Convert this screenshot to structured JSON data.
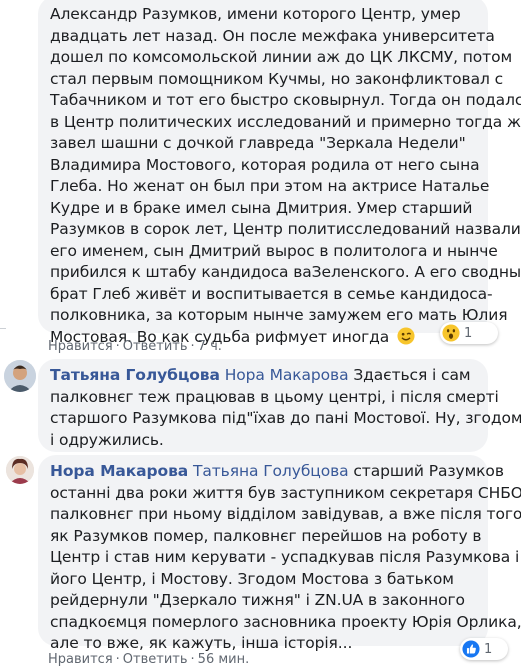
{
  "comment1": {
    "lines": [
      "Александр Разумков, имени которого Центр, умер",
      "двадцать лет назад. Он после межфака университета",
      "дошел по комсомольской линии аж до ЦК ЛКСМУ, потом",
      "стал первым помощником Кучмы, но законфликтовал с",
      "Табачником и тот его быстро сковырнул. Тогда он подался",
      "в Центр политических исследований и примерно тогда же",
      "завел шашни с дочкой главреда \"Зеркала Недели\"",
      "Владимира Мостового, которая родила от него сына",
      "Глеба. Но женат он был при этом на актрисе Наталье",
      "Кудре и в браке имел сына Дмитрия. Умер старший",
      "Разумков в сорок лет, Центр политисследований назвали",
      "его именем, сын Дмитрий вырос в политолога и нынче",
      "прибился к штабу кандидоса ваЗеленского. А его сводный",
      "брат Глеб живёт и воспитывается в семье кандидоса-",
      "полковника, за которым нынче замужем его мать Юлия"
    ],
    "last_line": "Мостовая. Во как судьба рифмует иногда",
    "emoji": "wink-emoji",
    "reactions": {
      "icon": "wow-reaction-icon",
      "count": "1"
    },
    "actions": {
      "like": "Нравится",
      "reply": "Ответить",
      "time": "7 ч."
    }
  },
  "comment2": {
    "author": "Татьяна Голубцова",
    "mention": "Нора Макарова",
    "first_text": "Здається і сам",
    "lines": [
      "палковнєг теж працював в цьому центрі, і після смерті",
      "старшого Разумкова під\"їхав до пані Мостової. Ну, згодом,",
      "і одружились."
    ]
  },
  "comment3": {
    "author": "Нора Макарова",
    "mention": "Татьяна Голубцова",
    "first_text": "старший Разумков",
    "lines": [
      "останні два роки життя був заступником секретаря СНБО,",
      "палковнєг при ньому відділом завідував, а вже після того,",
      "як Разумков помер, палковнєг перейшов на роботу в",
      "Центр і став ним керувати - успадкував після Разумкова і",
      "його Центр, і Мостову. Згодом Мостова з батьком",
      "рейдернули \"Дзеркало тижня\" і ZN.UA в законного",
      "спадкоємця померлого засновника проекту Юрія Орлика,",
      "але то вже, як кажуть, інша історія..."
    ],
    "reactions": {
      "count": "1"
    },
    "actions": {
      "like": "Нравится",
      "reply": "Ответить",
      "time": "56 мин."
    }
  },
  "colors": {
    "link": "#385898",
    "bubble": "#f2f3f5",
    "meta": "#606770",
    "text": "#1c1e21"
  }
}
